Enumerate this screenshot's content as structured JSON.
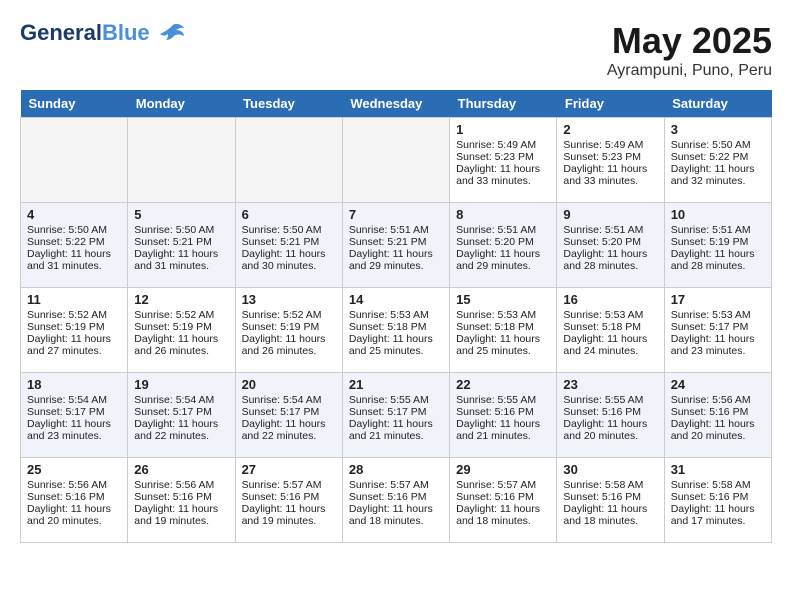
{
  "header": {
    "logo_general": "General",
    "logo_blue": "Blue",
    "title": "May 2025",
    "subtitle": "Ayrampuni, Puno, Peru"
  },
  "weekdays": [
    "Sunday",
    "Monday",
    "Tuesday",
    "Wednesday",
    "Thursday",
    "Friday",
    "Saturday"
  ],
  "weeks": [
    [
      {
        "day": "",
        "lines": []
      },
      {
        "day": "",
        "lines": []
      },
      {
        "day": "",
        "lines": []
      },
      {
        "day": "",
        "lines": []
      },
      {
        "day": "1",
        "lines": [
          "Sunrise: 5:49 AM",
          "Sunset: 5:23 PM",
          "Daylight: 11 hours",
          "and 33 minutes."
        ]
      },
      {
        "day": "2",
        "lines": [
          "Sunrise: 5:49 AM",
          "Sunset: 5:23 PM",
          "Daylight: 11 hours",
          "and 33 minutes."
        ]
      },
      {
        "day": "3",
        "lines": [
          "Sunrise: 5:50 AM",
          "Sunset: 5:22 PM",
          "Daylight: 11 hours",
          "and 32 minutes."
        ]
      }
    ],
    [
      {
        "day": "4",
        "lines": [
          "Sunrise: 5:50 AM",
          "Sunset: 5:22 PM",
          "Daylight: 11 hours",
          "and 31 minutes."
        ]
      },
      {
        "day": "5",
        "lines": [
          "Sunrise: 5:50 AM",
          "Sunset: 5:21 PM",
          "Daylight: 11 hours",
          "and 31 minutes."
        ]
      },
      {
        "day": "6",
        "lines": [
          "Sunrise: 5:50 AM",
          "Sunset: 5:21 PM",
          "Daylight: 11 hours",
          "and 30 minutes."
        ]
      },
      {
        "day": "7",
        "lines": [
          "Sunrise: 5:51 AM",
          "Sunset: 5:21 PM",
          "Daylight: 11 hours",
          "and 29 minutes."
        ]
      },
      {
        "day": "8",
        "lines": [
          "Sunrise: 5:51 AM",
          "Sunset: 5:20 PM",
          "Daylight: 11 hours",
          "and 29 minutes."
        ]
      },
      {
        "day": "9",
        "lines": [
          "Sunrise: 5:51 AM",
          "Sunset: 5:20 PM",
          "Daylight: 11 hours",
          "and 28 minutes."
        ]
      },
      {
        "day": "10",
        "lines": [
          "Sunrise: 5:51 AM",
          "Sunset: 5:19 PM",
          "Daylight: 11 hours",
          "and 28 minutes."
        ]
      }
    ],
    [
      {
        "day": "11",
        "lines": [
          "Sunrise: 5:52 AM",
          "Sunset: 5:19 PM",
          "Daylight: 11 hours",
          "and 27 minutes."
        ]
      },
      {
        "day": "12",
        "lines": [
          "Sunrise: 5:52 AM",
          "Sunset: 5:19 PM",
          "Daylight: 11 hours",
          "and 26 minutes."
        ]
      },
      {
        "day": "13",
        "lines": [
          "Sunrise: 5:52 AM",
          "Sunset: 5:19 PM",
          "Daylight: 11 hours",
          "and 26 minutes."
        ]
      },
      {
        "day": "14",
        "lines": [
          "Sunrise: 5:53 AM",
          "Sunset: 5:18 PM",
          "Daylight: 11 hours",
          "and 25 minutes."
        ]
      },
      {
        "day": "15",
        "lines": [
          "Sunrise: 5:53 AM",
          "Sunset: 5:18 PM",
          "Daylight: 11 hours",
          "and 25 minutes."
        ]
      },
      {
        "day": "16",
        "lines": [
          "Sunrise: 5:53 AM",
          "Sunset: 5:18 PM",
          "Daylight: 11 hours",
          "and 24 minutes."
        ]
      },
      {
        "day": "17",
        "lines": [
          "Sunrise: 5:53 AM",
          "Sunset: 5:17 PM",
          "Daylight: 11 hours",
          "and 23 minutes."
        ]
      }
    ],
    [
      {
        "day": "18",
        "lines": [
          "Sunrise: 5:54 AM",
          "Sunset: 5:17 PM",
          "Daylight: 11 hours",
          "and 23 minutes."
        ]
      },
      {
        "day": "19",
        "lines": [
          "Sunrise: 5:54 AM",
          "Sunset: 5:17 PM",
          "Daylight: 11 hours",
          "and 22 minutes."
        ]
      },
      {
        "day": "20",
        "lines": [
          "Sunrise: 5:54 AM",
          "Sunset: 5:17 PM",
          "Daylight: 11 hours",
          "and 22 minutes."
        ]
      },
      {
        "day": "21",
        "lines": [
          "Sunrise: 5:55 AM",
          "Sunset: 5:17 PM",
          "Daylight: 11 hours",
          "and 21 minutes."
        ]
      },
      {
        "day": "22",
        "lines": [
          "Sunrise: 5:55 AM",
          "Sunset: 5:16 PM",
          "Daylight: 11 hours",
          "and 21 minutes."
        ]
      },
      {
        "day": "23",
        "lines": [
          "Sunrise: 5:55 AM",
          "Sunset: 5:16 PM",
          "Daylight: 11 hours",
          "and 20 minutes."
        ]
      },
      {
        "day": "24",
        "lines": [
          "Sunrise: 5:56 AM",
          "Sunset: 5:16 PM",
          "Daylight: 11 hours",
          "and 20 minutes."
        ]
      }
    ],
    [
      {
        "day": "25",
        "lines": [
          "Sunrise: 5:56 AM",
          "Sunset: 5:16 PM",
          "Daylight: 11 hours",
          "and 20 minutes."
        ]
      },
      {
        "day": "26",
        "lines": [
          "Sunrise: 5:56 AM",
          "Sunset: 5:16 PM",
          "Daylight: 11 hours",
          "and 19 minutes."
        ]
      },
      {
        "day": "27",
        "lines": [
          "Sunrise: 5:57 AM",
          "Sunset: 5:16 PM",
          "Daylight: 11 hours",
          "and 19 minutes."
        ]
      },
      {
        "day": "28",
        "lines": [
          "Sunrise: 5:57 AM",
          "Sunset: 5:16 PM",
          "Daylight: 11 hours",
          "and 18 minutes."
        ]
      },
      {
        "day": "29",
        "lines": [
          "Sunrise: 5:57 AM",
          "Sunset: 5:16 PM",
          "Daylight: 11 hours",
          "and 18 minutes."
        ]
      },
      {
        "day": "30",
        "lines": [
          "Sunrise: 5:58 AM",
          "Sunset: 5:16 PM",
          "Daylight: 11 hours",
          "and 18 minutes."
        ]
      },
      {
        "day": "31",
        "lines": [
          "Sunrise: 5:58 AM",
          "Sunset: 5:16 PM",
          "Daylight: 11 hours",
          "and 17 minutes."
        ]
      }
    ]
  ]
}
